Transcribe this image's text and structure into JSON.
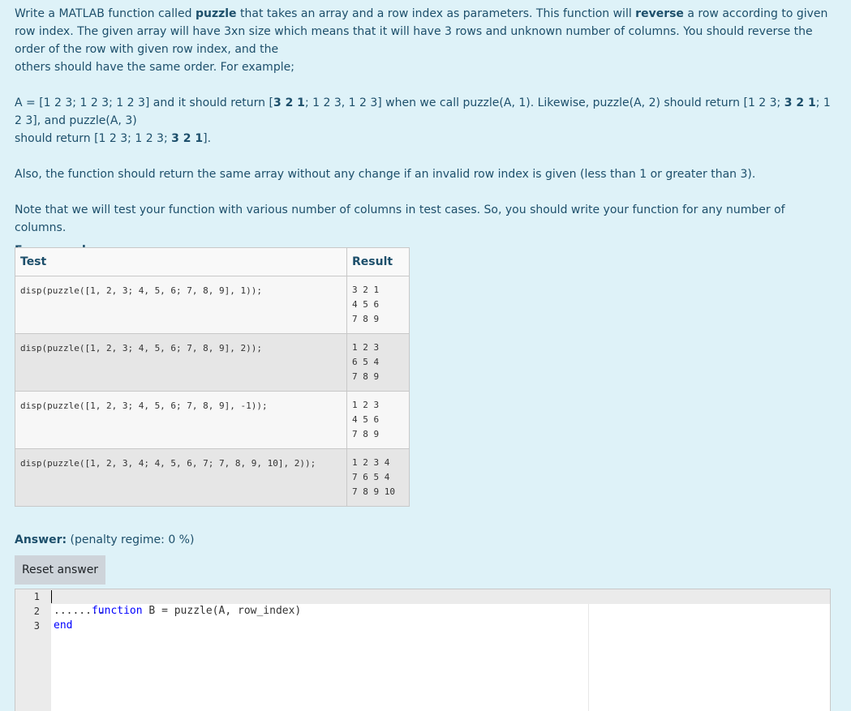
{
  "question": {
    "p1_a": "Write a MATLAB function called ",
    "p1_b": "puzzle",
    "p1_c": " that takes an array and a row index as parameters. This function will ",
    "p1_d": "reverse",
    "p1_e": " a row according to given row index. The given array will have 3xn size which means that it will have 3 rows and unknown number of columns. You should reverse the order of the row with given row index, and the",
    "p1_f": "others should have the same order. For example;",
    "p2_a": "A = [1 2 3; 1 2 3; 1 2 3] and it should return [",
    "p2_b": "3 2 1",
    "p2_c": "; 1 2 3, 1 2 3] when we call puzzle(A, 1). Likewise, puzzle(A, 2) should return [1 2 3; ",
    "p2_d": "3 2 1",
    "p2_e": "; 1 2 3], and puzzle(A, 3)",
    "p2_f": "should return [1 2 3; 1 2 3; ",
    "p2_g": "3 2 1",
    "p2_h": "].",
    "p3": "Also, the function should return the same array without any change if an invalid row index is given (less than 1 or greater than 3).",
    "p4": "Note that we will test your function with various number of columns in test cases. So, you should write your function for any number of columns.",
    "for_example": "For example:"
  },
  "examples_table": {
    "headers": [
      "Test",
      "Result"
    ],
    "rows": [
      {
        "test": "disp(puzzle([1, 2, 3; 4, 5, 6; 7, 8, 9], 1));",
        "result": "3 2 1\n4 5 6\n7 8 9"
      },
      {
        "test": "disp(puzzle([1, 2, 3; 4, 5, 6; 7, 8, 9], 2));",
        "result": "1 2 3\n6 5 4\n7 8 9"
      },
      {
        "test": "disp(puzzle([1, 2, 3; 4, 5, 6; 7, 8, 9], -1));",
        "result": "1 2 3\n4 5 6\n7 8 9"
      },
      {
        "test": "disp(puzzle([1, 2, 3, 4; 4, 5, 6, 7; 7, 8, 9, 10], 2));",
        "result": "1 2 3 4\n7 6 5 4\n7 8 9 10"
      }
    ]
  },
  "answer": {
    "label": "Answer:",
    "penalty": "(penalty regime: 0 %)",
    "reset_label": "Reset answer"
  },
  "editor": {
    "line_numbers": [
      "1",
      "2",
      "3"
    ],
    "line1_kw": "function",
    "line1_rest": " B = puzzle(A, row_index)",
    "line2": "........",
    "line3_kw": "end"
  }
}
